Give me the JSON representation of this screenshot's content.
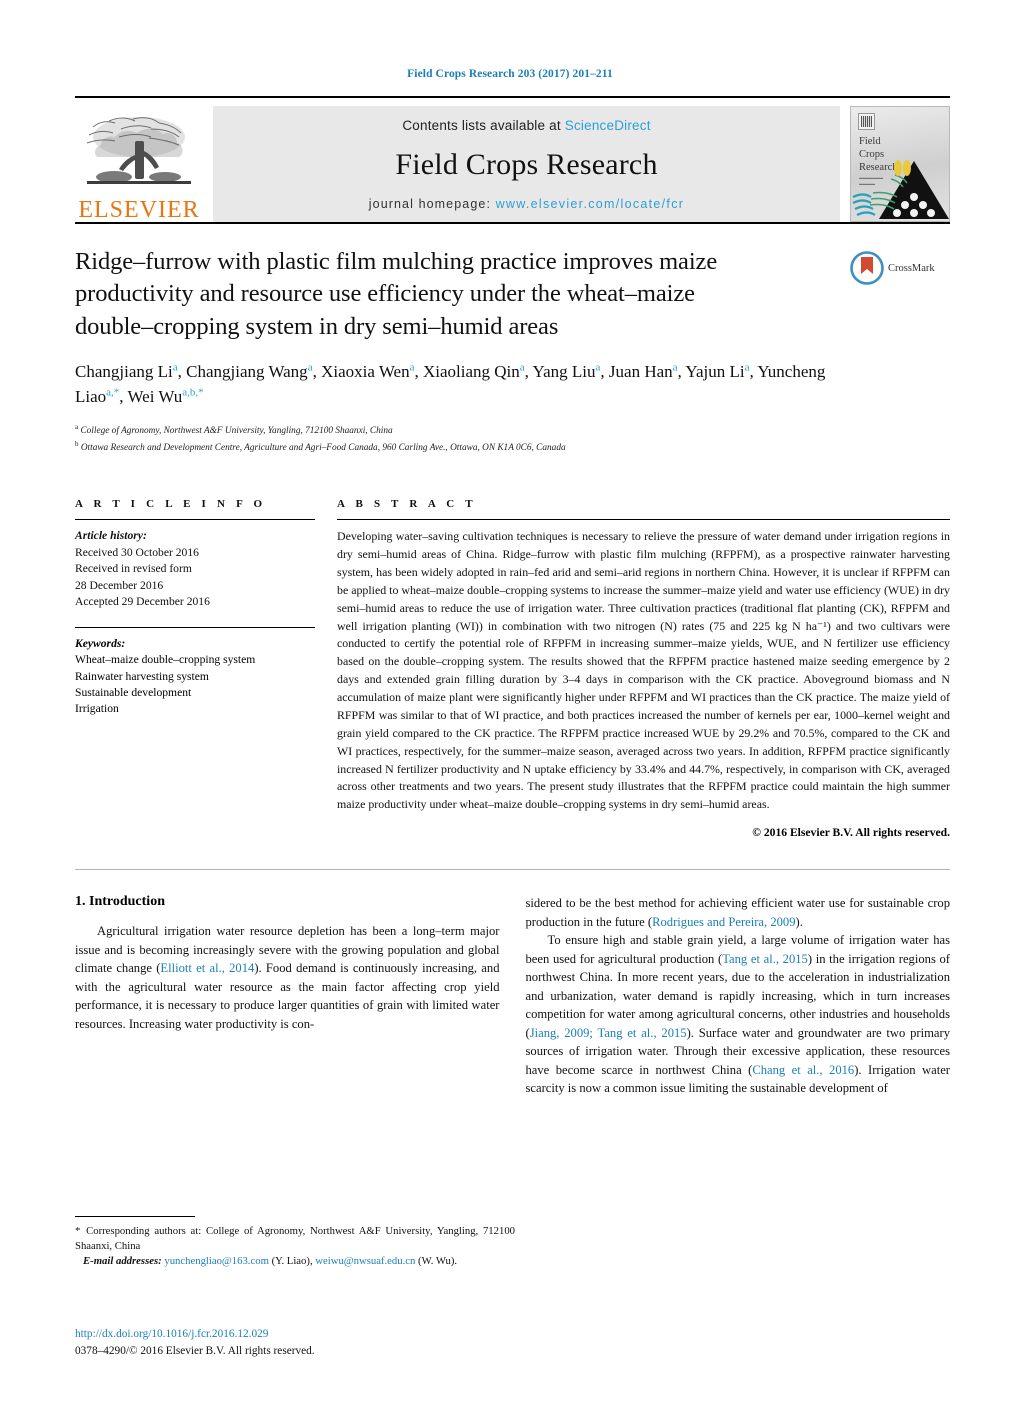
{
  "running_head": "Field Crops Research 203 (2017) 201–211",
  "masthead": {
    "publisher_name": "ELSEVIER",
    "contents_prefix": "Contents lists available at ",
    "sciencedirect": "ScienceDirect",
    "journal_title": "Field Crops Research",
    "homepage_prefix": "journal homepage: ",
    "homepage_url": "www.elsevier.com/locate/fcr",
    "cover_title": "Field\nCrops\nResearch",
    "cover_title_line1": "Field",
    "cover_title_line2": "Crops",
    "cover_title_line3": "Research"
  },
  "crossmark": {
    "label": "CrossMark"
  },
  "article": {
    "title": "Ridge–furrow with plastic film mulching practice improves maize productivity and resource use efficiency under the wheat–maize double–cropping system in dry semi–humid areas",
    "authors_line1": "Changjiang Li",
    "authors": [
      {
        "name": "Changjiang Li",
        "sup": "a"
      },
      {
        "name": "Changjiang Wang",
        "sup": "a"
      },
      {
        "name": "Xiaoxia Wen",
        "sup": "a"
      },
      {
        "name": "Xiaoliang Qin",
        "sup": "a"
      },
      {
        "name": "Yang Liu",
        "sup": "a"
      },
      {
        "name": "Juan Han",
        "sup": "a"
      },
      {
        "name": "Yajun Li",
        "sup": "a"
      },
      {
        "name": "Yuncheng Liao",
        "sup": "a,*"
      },
      {
        "name": "Wei Wu",
        "sup": "a,b,*"
      }
    ],
    "affiliations": [
      {
        "marker": "a",
        "text": "College of Agronomy, Northwest A&F University, Yangling, 712100 Shaanxi, China"
      },
      {
        "marker": "b",
        "text": "Ottawa Research and Development Centre, Agriculture and Agri–Food Canada, 960 Carling Ave., Ottawa, ON K1A 0C6, Canada"
      }
    ]
  },
  "article_info": {
    "heading": "A R T I C L E   I N F O",
    "history_label": "Article history:",
    "history": [
      "Received 30 October 2016",
      "Received in revised form",
      "28 December 2016",
      "Accepted 29 December 2016"
    ],
    "keywords_label": "Keywords:",
    "keywords": [
      "Wheat–maize double–cropping system",
      "Rainwater harvesting system",
      "Sustainable development",
      "Irrigation"
    ]
  },
  "abstract": {
    "heading": "A B S T R A C T",
    "text": "Developing water–saving cultivation techniques is necessary to relieve the pressure of water demand under irrigation regions in dry semi–humid areas of China. Ridge–furrow with plastic film mulching (RFPFM), as a prospective rainwater harvesting system, has been widely adopted in rain–fed arid and semi–arid regions in northern China. However, it is unclear if RFPFM can be applied to wheat–maize double–cropping systems to increase the summer–maize yield and water use efficiency (WUE) in dry semi–humid areas to reduce the use of irrigation water. Three cultivation practices (traditional flat planting (CK), RFPFM and well irrigation planting (WI)) in combination with two nitrogen (N) rates (75 and 225 kg N ha⁻¹) and two cultivars were conducted to certify the potential role of RFPFM in increasing summer–maize yields, WUE, and N fertilizer use efficiency based on the double–cropping system. The results showed that the RFPFM practice hastened maize seeding emergence by 2 days and extended grain filling duration by 3–4 days in comparison with the CK practice. Aboveground biomass and N accumulation of maize plant were significantly higher under RFPFM and WI practices than the CK practice. The maize yield of RFPFM was similar to that of WI practice, and both practices increased the number of kernels per ear, 1000–kernel weight and grain yield compared to the CK practice. The RFPFM practice increased WUE by 29.2% and 70.5%, compared to the CK and WI practices, respectively, for the summer–maize season, averaged across two years. In addition, RFPFM practice significantly increased N fertilizer productivity and N uptake efficiency by 33.4% and 44.7%, respectively, in comparison with CK, averaged across other treatments and two years. The present study illustrates that the RFPFM practice could maintain the high summer maize productivity under wheat–maize double–cropping systems in dry semi–humid areas.",
    "copyright": "© 2016 Elsevier B.V. All rights reserved."
  },
  "introduction": {
    "heading": "1.  Introduction",
    "left_para_1_a": "Agricultural irrigation water resource depletion has been a long–term major issue and is becoming increasingly severe with the growing population and global climate change (",
    "left_ref_1": "Elliott et al., 2014",
    "left_para_1_b": "). Food demand is continuously increasing, and with the agricultural water resource as the main factor affecting crop yield performance, it is necessary to produce larger quantities of grain with limited water resources. Increasing water productivity is con-",
    "right_para_1_a": "sidered to be the best method for achieving efficient water use for sustainable crop production in the future (",
    "right_ref_1": "Rodrigues and Pereira, 2009",
    "right_para_1_b": ").",
    "right_para_2_a": "To ensure high and stable grain yield, a large volume of irrigation water has been used for agricultural production (",
    "right_ref_2": "Tang et al., 2015",
    "right_para_2_b": ") in the irrigation regions of northwest China. In more recent years, due to the acceleration in industrialization and urbanization, water demand is rapidly increasing, which in turn increases competition for water among agricultural concerns, other industries and households (",
    "right_ref_3": "Jiang, 2009; Tang et al., 2015",
    "right_para_2_c": "). Surface water and groundwater are two primary sources of irrigation water. Through their excessive application, these resources have become scarce in northwest China (",
    "right_ref_4": "Chang et al., 2016",
    "right_para_2_d": "). Irrigation water scarcity is now a common issue limiting the sustainable development of"
  },
  "footnote": {
    "star": "*",
    "corresponding": "Corresponding authors at: College of Agronomy, Northwest A&F University, Yangling, 712100 Shaanxi, China",
    "email_label": "E-mail addresses:",
    "email1": "yunchengliao@163.com",
    "email1_owner": "(Y. Liao),",
    "email2": "weiwu@nwsuaf.edu.cn",
    "email2_owner": "(W. Wu).",
    "doi": "http://dx.doi.org/10.1016/j.fcr.2016.12.029",
    "issn": "0378–4290/© 2016 Elsevier B.V. All rights reserved."
  },
  "colors": {
    "link_blue": "#1a7fb5",
    "elsevier_orange": "#E87511",
    "band_gray": "#e8e8e8",
    "sciencedirect_blue": "#2e9fd4"
  }
}
